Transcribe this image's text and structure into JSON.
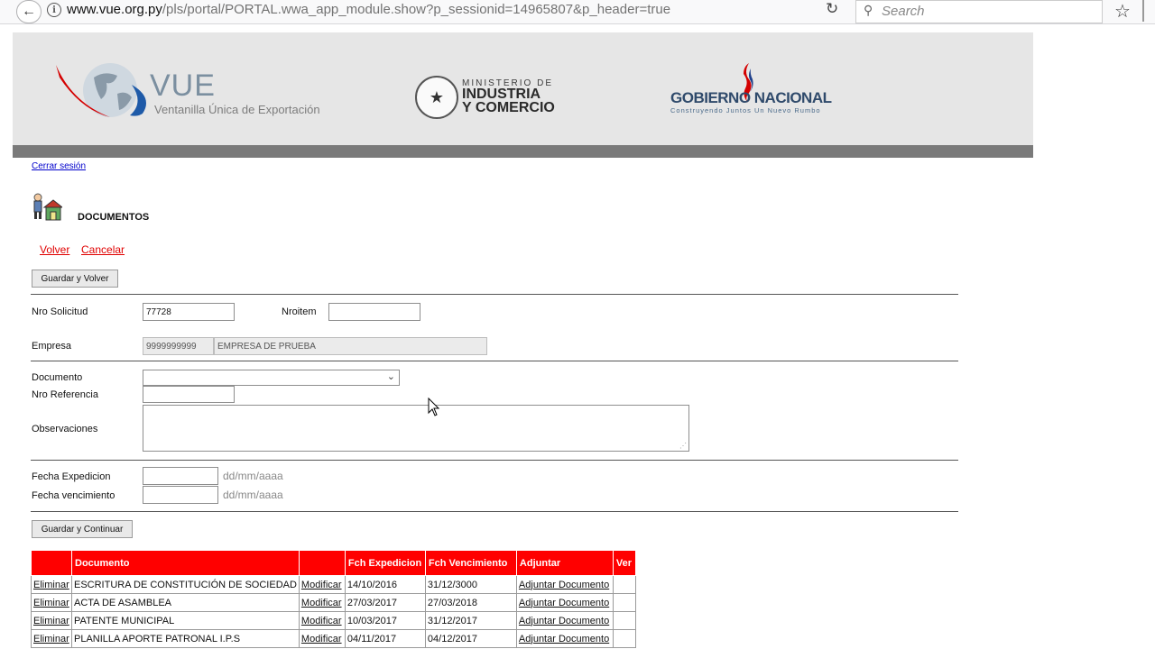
{
  "browser": {
    "url_host": "www.vue.org.py",
    "url_path": "/pls/portal/PORTAL.wwa_app_module.show?p_sessionid=14965807&p_header=true",
    "search_placeholder": "Search"
  },
  "banner": {
    "vue_title": "VUE",
    "vue_subtitle": "Ventanilla Única de Exportación",
    "mic_small": "MINISTERIO DE",
    "mic_line1": "INDUSTRIA",
    "mic_line2": "Y COMERCIO",
    "gob_title": "GOBIERNO NACIONAL",
    "gob_subtitle": "Construyendo Juntos Un Nuevo Rumbo"
  },
  "page": {
    "logout": "Cerrar sesión",
    "title": "DOCUMENTOS",
    "nav_back": "Volver",
    "nav_cancel": "Cancelar",
    "save_back": "Guardar y Volver",
    "save_continue": "Guardar y Continuar"
  },
  "form": {
    "nro_solicitud_label": "Nro Solicitud",
    "nro_solicitud_value": "77728",
    "nroitem_label": "Nroitem",
    "nroitem_value": "",
    "empresa_label": "Empresa",
    "empresa_code": "9999999999",
    "empresa_name": "EMPRESA DE PRUEBA",
    "documento_label": "Documento",
    "documento_value": "",
    "nro_referencia_label": "Nro Referencia",
    "observaciones_label": "Observaciones",
    "fecha_expedicion_label": "Fecha Expedicion",
    "fecha_vencimiento_label": "Fecha vencimiento",
    "date_hint": "dd/mm/aaaa"
  },
  "table": {
    "headers": [
      "",
      "Documento",
      "",
      "Fch Expedicion",
      "Fch Vencimiento",
      "Adjuntar",
      "Ver"
    ],
    "rows": [
      {
        "delete": "Eliminar",
        "doc": "ESCRITURA DE CONSTITUCIÓN DE SOCIEDAD",
        "edit": "Modificar",
        "exp": "14/10/2016",
        "venc": "31/12/3000",
        "attach": "Adjuntar Documento",
        "ver": ""
      },
      {
        "delete": "Eliminar",
        "doc": "ACTA DE ASAMBLEA",
        "edit": "Modificar",
        "exp": "27/03/2017",
        "venc": "27/03/2018",
        "attach": "Adjuntar Documento",
        "ver": ""
      },
      {
        "delete": "Eliminar",
        "doc": "PATENTE MUNICIPAL",
        "edit": "Modificar",
        "exp": "10/03/2017",
        "venc": "31/12/2017",
        "attach": "Adjuntar Documento",
        "ver": ""
      },
      {
        "delete": "Eliminar",
        "doc": "PLANILLA APORTE PATRONAL I.P.S",
        "edit": "Modificar",
        "exp": "04/11/2017",
        "venc": "04/12/2017",
        "attach": "Adjuntar Documento",
        "ver": ""
      }
    ]
  },
  "colors": {
    "accent_red": "#e00000",
    "header_red": "#ff0000",
    "link_blue": "#0000cc"
  }
}
